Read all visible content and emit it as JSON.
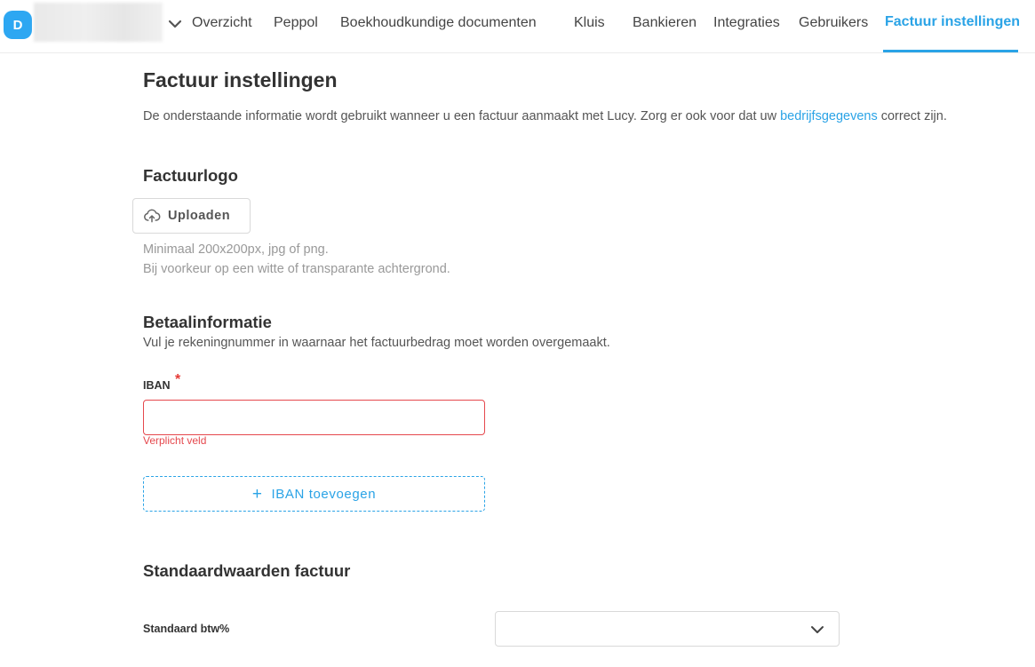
{
  "header": {
    "avatar_letter": "D",
    "nav": [
      {
        "label": "Overzicht"
      },
      {
        "label": "Peppol"
      },
      {
        "label": "Boekhoudkundige documenten"
      },
      {
        "label": "Kluis"
      },
      {
        "label": "Bankieren"
      },
      {
        "label": "Integraties"
      },
      {
        "label": "Gebruikers"
      },
      {
        "label": "Factuur instellingen",
        "active": true
      }
    ]
  },
  "page": {
    "title": "Factuur instellingen",
    "intro_before": "De onderstaande informatie wordt gebruikt wanneer u een factuur aanmaakt met Lucy. Zorg er ook voor dat uw ",
    "intro_link": "bedrijfsgegevens",
    "intro_after": " correct zijn."
  },
  "logo_section": {
    "title": "Factuurlogo",
    "upload_label": "Uploaden",
    "hint_line1": "Minimaal 200x200px, jpg of png.",
    "hint_line2": "Bij voorkeur op een witte of transparante achtergrond."
  },
  "payment_section": {
    "title": "Betaalinformatie",
    "subtitle": "Vul je rekeningnummer in waarnaar het factuurbedrag moet worden overgemaakt.",
    "iban_label": "IBAN",
    "required_mark": "*",
    "iban_value": "",
    "error": "Verplicht veld",
    "add_iban_label": "IBAN toevoegen",
    "add_iban_plus": "+"
  },
  "defaults_section": {
    "title": "Standaardwaarden factuur",
    "vat_label": "Standaard btw%",
    "vat_value": ""
  },
  "colors": {
    "accent": "#2aa3e6",
    "avatar": "#2da7f2",
    "error": "#e5484d"
  },
  "icons": {
    "company_dropdown": "chevron-down-icon",
    "upload": "cloud-upload-icon",
    "add": "plus-icon",
    "select": "chevron-down-icon"
  }
}
